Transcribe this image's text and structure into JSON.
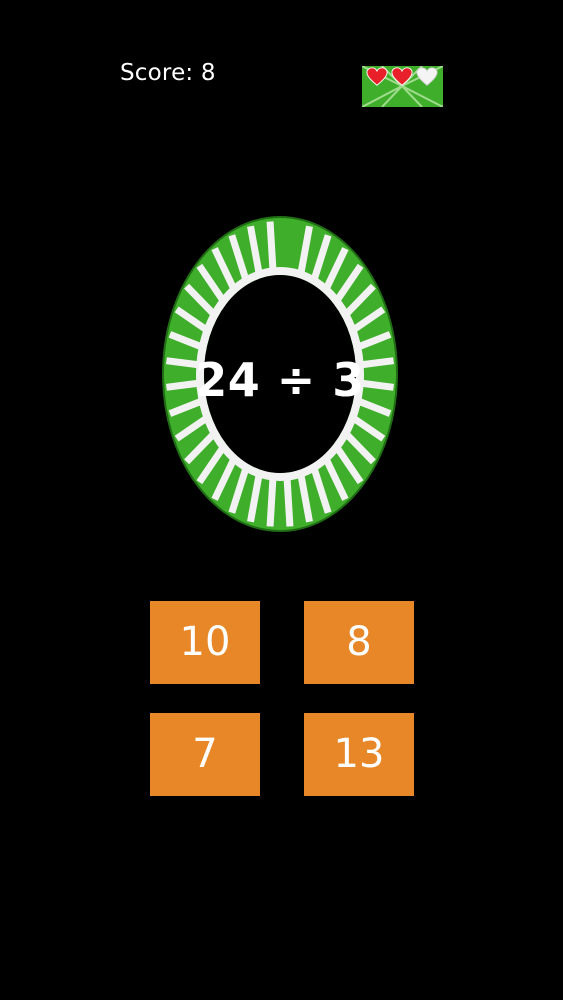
{
  "score": {
    "text": "Score: 8"
  },
  "lives": {
    "filled": 2,
    "total": 3
  },
  "problem": {
    "expression": "24 ÷ 3"
  },
  "answers": [
    {
      "label": "10"
    },
    {
      "label": "8"
    },
    {
      "label": "7"
    },
    {
      "label": "13"
    }
  ],
  "colors": {
    "background": "#000000",
    "dial_green": "#3fae2a",
    "answer_orange": "#e88728",
    "heart_red": "#e8202a"
  }
}
